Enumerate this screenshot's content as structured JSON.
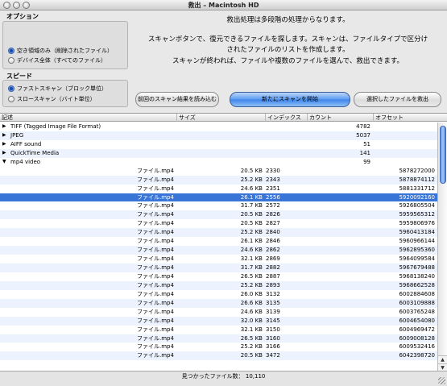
{
  "window": {
    "title": "救出 – Macintosh HD"
  },
  "options": {
    "title": "オプション",
    "choices": [
      {
        "label": "空き領域のみ（削除されたファイル）",
        "selected": true
      },
      {
        "label": "デバイス全体（すべてのファイル）",
        "selected": false
      }
    ]
  },
  "speed": {
    "title": "スピード",
    "choices": [
      {
        "label": "ファストスキャン（ブロック単位）",
        "selected": true
      },
      {
        "label": "スロースキャン（バイト単位）",
        "selected": false
      }
    ]
  },
  "description": {
    "line1": "救出処理は多段階の処理からなります。",
    "line2": "スキャンボタンで、復元できるファイルを探します。スキャンは、ファイルタイプで区分け",
    "line3": "されたファイルのリストを作成します。",
    "line4": "スキャンが終われば、ファイルや複数のファイルを選んで、救出できます。"
  },
  "buttons": {
    "load_previous": "前回のスキャン結果を読み込む",
    "new_scan": "新たにスキャンを開始",
    "rescue_selected": "選択したファイルを救出"
  },
  "table": {
    "columns": {
      "desc": "記述",
      "size": "サイズ",
      "index": "インデックス",
      "count": "カウント",
      "offset": "オフセット"
    },
    "groups": [
      {
        "name": "TIFF (Tagged Image File Format)",
        "count": "4782",
        "expanded": false
      },
      {
        "name": "JPEG",
        "count": "5037",
        "expanded": false
      },
      {
        "name": "AIFF sound",
        "count": "51",
        "expanded": false
      },
      {
        "name": "QuickTime Media",
        "count": "141",
        "expanded": false
      },
      {
        "name": "mp4 video",
        "count": "99",
        "expanded": true
      }
    ],
    "files": [
      {
        "name": "ファイル.mp4",
        "size": "20.5 KB",
        "index": "2330",
        "offset": "5878272000"
      },
      {
        "name": "ファイル.mp4",
        "size": "25.2 KB",
        "index": "2343",
        "offset": "5878874112"
      },
      {
        "name": "ファイル.mp4",
        "size": "24.6 KB",
        "index": "2351",
        "offset": "5881331712"
      },
      {
        "name": "ファイル.mp4",
        "size": "26.1 KB",
        "index": "2556",
        "offset": "5920092160",
        "selected": true
      },
      {
        "name": "ファイル.mp4",
        "size": "31.7 KB",
        "index": "2572",
        "offset": "5926805504"
      },
      {
        "name": "ファイル.mp4",
        "size": "20.5 KB",
        "index": "2826",
        "offset": "5959565312"
      },
      {
        "name": "ファイル.mp4",
        "size": "20.5 KB",
        "index": "2827",
        "offset": "5959806976"
      },
      {
        "name": "ファイル.mp4",
        "size": "25.2 KB",
        "index": "2840",
        "offset": "5960413184"
      },
      {
        "name": "ファイル.mp4",
        "size": "26.1 KB",
        "index": "2846",
        "offset": "5960966144"
      },
      {
        "name": "ファイル.mp4",
        "size": "24.6 KB",
        "index": "2862",
        "offset": "5962895360"
      },
      {
        "name": "ファイル.mp4",
        "size": "32.1 KB",
        "index": "2869",
        "offset": "5964099584"
      },
      {
        "name": "ファイル.mp4",
        "size": "31.7 KB",
        "index": "2882",
        "offset": "5967679488"
      },
      {
        "name": "ファイル.mp4",
        "size": "26.5 KB",
        "index": "2887",
        "offset": "5968138240"
      },
      {
        "name": "ファイル.mp4",
        "size": "25.2 KB",
        "index": "2893",
        "offset": "5968662528"
      },
      {
        "name": "ファイル.mp4",
        "size": "26.0 KB",
        "index": "3132",
        "offset": "6002884608"
      },
      {
        "name": "ファイル.mp4",
        "size": "26.6 KB",
        "index": "3135",
        "offset": "6003109888"
      },
      {
        "name": "ファイル.mp4",
        "size": "24.6 KB",
        "index": "3139",
        "offset": "6003765248"
      },
      {
        "name": "ファイル.mp4",
        "size": "32.0 KB",
        "index": "3145",
        "offset": "6004654080"
      },
      {
        "name": "ファイル.mp4",
        "size": "32.1 KB",
        "index": "3150",
        "offset": "6004969472"
      },
      {
        "name": "ファイル.mp4",
        "size": "26.5 KB",
        "index": "3160",
        "offset": "6009008128"
      },
      {
        "name": "ファイル.mp4",
        "size": "25.2 KB",
        "index": "3166",
        "offset": "6009532416"
      },
      {
        "name": "ファイル.mp4",
        "size": "20.5 KB",
        "index": "3472",
        "offset": "6042398720"
      }
    ]
  },
  "status": {
    "found_label": "見つかったファイル数：",
    "found_count": "10,110"
  },
  "colors": {
    "selection": "#3875d7",
    "alt_row": "#edf3fe",
    "primary_button": "#5a9af0"
  }
}
